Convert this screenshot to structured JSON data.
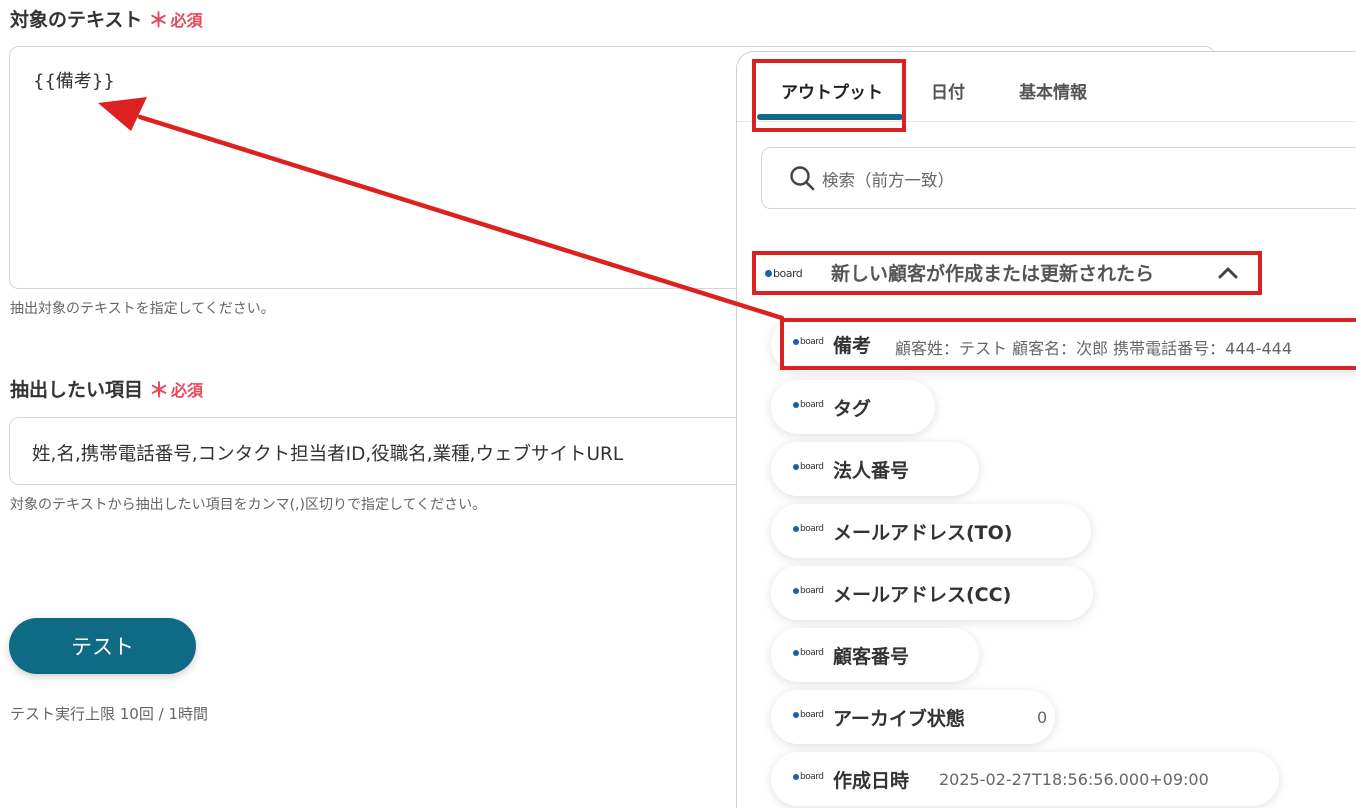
{
  "form": {
    "target_text": {
      "label": "対象のテキスト",
      "required_mark": "＊",
      "required_text": "必須",
      "value": "{{備考}}",
      "hint": "抽出対象のテキストを指定してください。"
    },
    "extract_items": {
      "label": "抽出したい項目",
      "required_mark": "＊",
      "required_text": "必須",
      "value": "姓,名,携帯電話番号,コンタクト担当者ID,役職名,業種,ウェブサイトURL",
      "hint": "対象のテキストから抽出したい項目をカンマ(,)区切りで指定してください。"
    },
    "test_button_label": "テスト",
    "test_limit_text": "テスト実行上限 10回 / 1時間"
  },
  "panel": {
    "tabs": [
      {
        "label": "アウトプット",
        "active": true
      },
      {
        "label": "日付",
        "active": false
      },
      {
        "label": "基本情報",
        "active": false
      }
    ],
    "search_placeholder": "検索（前方一致）",
    "group": {
      "logo_text": "board",
      "title": "新しい顧客が作成または更新されたら",
      "expanded": true
    },
    "items": [
      {
        "label": "備考",
        "value": "顧客姓：テスト 顧客名：次郎 携帯電話番号：444-444"
      },
      {
        "label": "タグ",
        "value": ""
      },
      {
        "label": "法人番号",
        "value": ""
      },
      {
        "label": "メールアドレス(TO)",
        "value": ""
      },
      {
        "label": "メールアドレス(CC)",
        "value": ""
      },
      {
        "label": "顧客番号",
        "value": ""
      },
      {
        "label": "アーカイブ状態",
        "value": "0"
      },
      {
        "label": "作成日時",
        "value": "2025-02-27T18:56:56.000+09:00"
      }
    ]
  },
  "colors": {
    "accent": "#0f6a85",
    "required": "#e8485a",
    "annotation": "#dd2020"
  }
}
